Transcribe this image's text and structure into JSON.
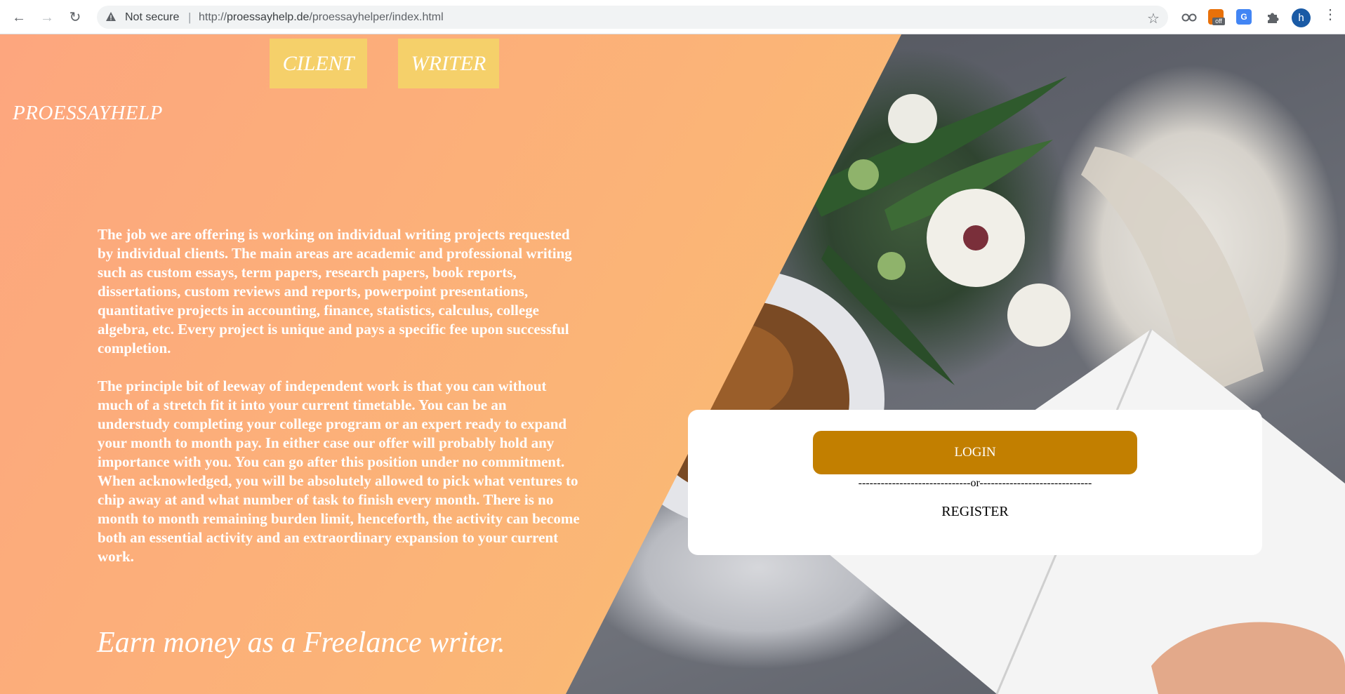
{
  "browser": {
    "security_label": "Not secure",
    "separator": "|",
    "url_prefix": "http://",
    "url_host": "proessayhelp.de",
    "url_path": "/proessayhelper/index.html",
    "extension_badge": "off",
    "profile_initial": "h"
  },
  "nav": {
    "client_label": "CILENT",
    "writer_label": "WRITER"
  },
  "brand": "PROESSAYHELP",
  "content": {
    "paragraph_1": "The job we are offering is working on individual writing projects requested by individual clients. The main areas are academic and professional writing such as custom essays, term papers, research papers, book reports, dissertations, custom reviews and reports, powerpoint presentations, quantitative projects in accounting, finance, statistics, calculus, college algebra, etc. Every project is unique and pays a specific fee upon successful completion.",
    "paragraph_2": "The principle bit of leeway of independent work is that you can without much of a stretch fit it into your current timetable. You can be an understudy completing your college program or an expert ready to expand your month to month pay. In either case our offer will probably hold any importance with you. You can go after this position under no commitment. When acknowledged, you will be absolutely allowed to pick what ventures to chip away at and what number of task to finish every month. There is no month to month remaining burden limit, henceforth, the activity can become both an essential activity and an extraordinary expansion to your current work.",
    "tagline": "Earn money as a Freelance writer."
  },
  "auth": {
    "login_label": "LOGIN",
    "or_divider": "------------------------------or------------------------------",
    "register_label": "REGISTER"
  },
  "colors": {
    "panel_start": "#fda67e",
    "panel_end": "#f7c96b",
    "top_button": "#f5d06a",
    "login_button": "#c27f00"
  }
}
